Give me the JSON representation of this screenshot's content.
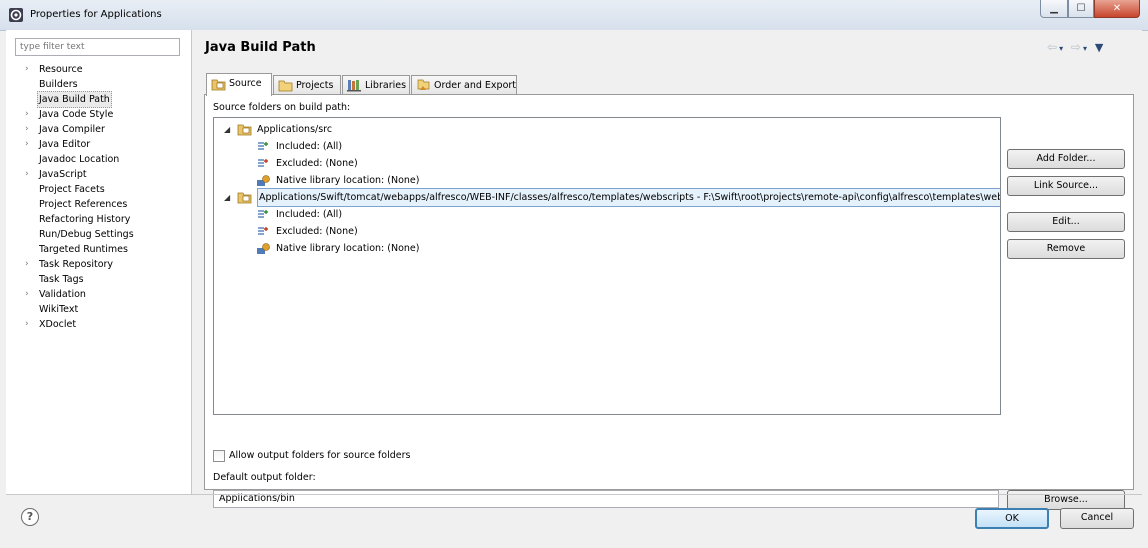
{
  "window": {
    "title": "Properties for Applications",
    "min_symbol": "▁",
    "max_symbol": "☐",
    "close_symbol": "✕"
  },
  "left": {
    "filter_placeholder": "type filter text",
    "items": [
      {
        "label": "Resource",
        "expandable": true
      },
      {
        "label": "Builders",
        "expandable": false
      },
      {
        "label": "Java Build Path",
        "expandable": false,
        "selected": true
      },
      {
        "label": "Java Code Style",
        "expandable": true
      },
      {
        "label": "Java Compiler",
        "expandable": true
      },
      {
        "label": "Java Editor",
        "expandable": true
      },
      {
        "label": "Javadoc Location",
        "expandable": false
      },
      {
        "label": "JavaScript",
        "expandable": true
      },
      {
        "label": "Project Facets",
        "expandable": false
      },
      {
        "label": "Project References",
        "expandable": false
      },
      {
        "label": "Refactoring History",
        "expandable": false
      },
      {
        "label": "Run/Debug Settings",
        "expandable": false
      },
      {
        "label": "Targeted Runtimes",
        "expandable": false
      },
      {
        "label": "Task Repository",
        "expandable": true
      },
      {
        "label": "Task Tags",
        "expandable": false
      },
      {
        "label": "Validation",
        "expandable": true
      },
      {
        "label": "WikiText",
        "expandable": false
      },
      {
        "label": "XDoclet",
        "expandable": true
      }
    ]
  },
  "page": {
    "title": "Java Build Path"
  },
  "tabs": [
    {
      "label": "Source",
      "icon": "source-folder-icon",
      "active": true
    },
    {
      "label": "Projects",
      "icon": "projects-folder-icon",
      "active": false
    },
    {
      "label": "Libraries",
      "icon": "libraries-icon",
      "active": false
    },
    {
      "label": "Order and Export",
      "icon": "order-export-icon",
      "active": false
    }
  ],
  "source": {
    "section_label": "Source folders on build path:",
    "folders": [
      {
        "path": "Applications/src",
        "selected": false,
        "children": [
          "Included: (All)",
          "Excluded: (None)",
          "Native library location: (None)"
        ]
      },
      {
        "path": "Applications/Swift/tomcat/webapps/alfresco/WEB-INF/classes/alfresco/templates/webscripts - F:\\Swift\\root\\projects\\remote-api\\config\\alfresco\\templates\\webscripts",
        "selected": true,
        "children": [
          "Included: (All)",
          "Excluded: (None)",
          "Native library location: (None)"
        ]
      }
    ],
    "buttons": {
      "add_folder": "Add Folder...",
      "link_source": "Link Source...",
      "edit": "Edit...",
      "remove": "Remove"
    },
    "allow_output_label": "Allow output folders for source folders",
    "allow_output_checked": false,
    "default_output_label": "Default output folder:",
    "default_output_value": "Applications/bin",
    "browse_label": "Browse..."
  },
  "footer": {
    "ok_label": "OK",
    "cancel_label": "Cancel"
  },
  "colors": {
    "selection_bg": "#e5f1fb",
    "selection_border": "#7da2ce",
    "default_button_border": "#3c7fb1"
  }
}
